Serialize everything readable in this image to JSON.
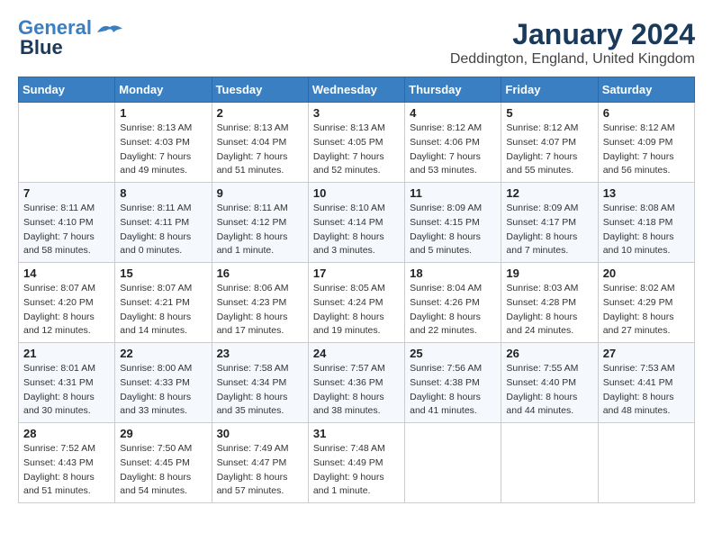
{
  "logo": {
    "line1": "General",
    "line2": "Blue"
  },
  "title": "January 2024",
  "subtitle": "Deddington, England, United Kingdom",
  "days_header": [
    "Sunday",
    "Monday",
    "Tuesday",
    "Wednesday",
    "Thursday",
    "Friday",
    "Saturday"
  ],
  "weeks": [
    [
      {
        "day": "",
        "info": ""
      },
      {
        "day": "1",
        "info": "Sunrise: 8:13 AM\nSunset: 4:03 PM\nDaylight: 7 hours\nand 49 minutes."
      },
      {
        "day": "2",
        "info": "Sunrise: 8:13 AM\nSunset: 4:04 PM\nDaylight: 7 hours\nand 51 minutes."
      },
      {
        "day": "3",
        "info": "Sunrise: 8:13 AM\nSunset: 4:05 PM\nDaylight: 7 hours\nand 52 minutes."
      },
      {
        "day": "4",
        "info": "Sunrise: 8:12 AM\nSunset: 4:06 PM\nDaylight: 7 hours\nand 53 minutes."
      },
      {
        "day": "5",
        "info": "Sunrise: 8:12 AM\nSunset: 4:07 PM\nDaylight: 7 hours\nand 55 minutes."
      },
      {
        "day": "6",
        "info": "Sunrise: 8:12 AM\nSunset: 4:09 PM\nDaylight: 7 hours\nand 56 minutes."
      }
    ],
    [
      {
        "day": "7",
        "info": "Sunrise: 8:11 AM\nSunset: 4:10 PM\nDaylight: 7 hours\nand 58 minutes."
      },
      {
        "day": "8",
        "info": "Sunrise: 8:11 AM\nSunset: 4:11 PM\nDaylight: 8 hours\nand 0 minutes."
      },
      {
        "day": "9",
        "info": "Sunrise: 8:11 AM\nSunset: 4:12 PM\nDaylight: 8 hours\nand 1 minute."
      },
      {
        "day": "10",
        "info": "Sunrise: 8:10 AM\nSunset: 4:14 PM\nDaylight: 8 hours\nand 3 minutes."
      },
      {
        "day": "11",
        "info": "Sunrise: 8:09 AM\nSunset: 4:15 PM\nDaylight: 8 hours\nand 5 minutes."
      },
      {
        "day": "12",
        "info": "Sunrise: 8:09 AM\nSunset: 4:17 PM\nDaylight: 8 hours\nand 7 minutes."
      },
      {
        "day": "13",
        "info": "Sunrise: 8:08 AM\nSunset: 4:18 PM\nDaylight: 8 hours\nand 10 minutes."
      }
    ],
    [
      {
        "day": "14",
        "info": "Sunrise: 8:07 AM\nSunset: 4:20 PM\nDaylight: 8 hours\nand 12 minutes."
      },
      {
        "day": "15",
        "info": "Sunrise: 8:07 AM\nSunset: 4:21 PM\nDaylight: 8 hours\nand 14 minutes."
      },
      {
        "day": "16",
        "info": "Sunrise: 8:06 AM\nSunset: 4:23 PM\nDaylight: 8 hours\nand 17 minutes."
      },
      {
        "day": "17",
        "info": "Sunrise: 8:05 AM\nSunset: 4:24 PM\nDaylight: 8 hours\nand 19 minutes."
      },
      {
        "day": "18",
        "info": "Sunrise: 8:04 AM\nSunset: 4:26 PM\nDaylight: 8 hours\nand 22 minutes."
      },
      {
        "day": "19",
        "info": "Sunrise: 8:03 AM\nSunset: 4:28 PM\nDaylight: 8 hours\nand 24 minutes."
      },
      {
        "day": "20",
        "info": "Sunrise: 8:02 AM\nSunset: 4:29 PM\nDaylight: 8 hours\nand 27 minutes."
      }
    ],
    [
      {
        "day": "21",
        "info": "Sunrise: 8:01 AM\nSunset: 4:31 PM\nDaylight: 8 hours\nand 30 minutes."
      },
      {
        "day": "22",
        "info": "Sunrise: 8:00 AM\nSunset: 4:33 PM\nDaylight: 8 hours\nand 33 minutes."
      },
      {
        "day": "23",
        "info": "Sunrise: 7:58 AM\nSunset: 4:34 PM\nDaylight: 8 hours\nand 35 minutes."
      },
      {
        "day": "24",
        "info": "Sunrise: 7:57 AM\nSunset: 4:36 PM\nDaylight: 8 hours\nand 38 minutes."
      },
      {
        "day": "25",
        "info": "Sunrise: 7:56 AM\nSunset: 4:38 PM\nDaylight: 8 hours\nand 41 minutes."
      },
      {
        "day": "26",
        "info": "Sunrise: 7:55 AM\nSunset: 4:40 PM\nDaylight: 8 hours\nand 44 minutes."
      },
      {
        "day": "27",
        "info": "Sunrise: 7:53 AM\nSunset: 4:41 PM\nDaylight: 8 hours\nand 48 minutes."
      }
    ],
    [
      {
        "day": "28",
        "info": "Sunrise: 7:52 AM\nSunset: 4:43 PM\nDaylight: 8 hours\nand 51 minutes."
      },
      {
        "day": "29",
        "info": "Sunrise: 7:50 AM\nSunset: 4:45 PM\nDaylight: 8 hours\nand 54 minutes."
      },
      {
        "day": "30",
        "info": "Sunrise: 7:49 AM\nSunset: 4:47 PM\nDaylight: 8 hours\nand 57 minutes."
      },
      {
        "day": "31",
        "info": "Sunrise: 7:48 AM\nSunset: 4:49 PM\nDaylight: 9 hours\nand 1 minute."
      },
      {
        "day": "",
        "info": ""
      },
      {
        "day": "",
        "info": ""
      },
      {
        "day": "",
        "info": ""
      }
    ]
  ]
}
